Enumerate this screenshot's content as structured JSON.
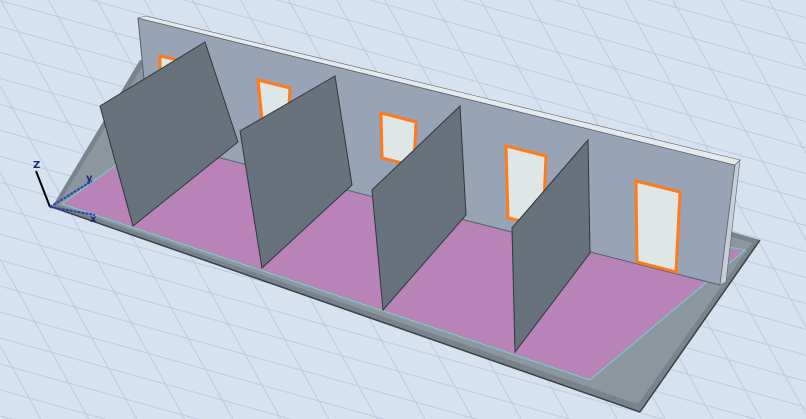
{
  "viewport": {
    "type": "3D model view",
    "axes": {
      "z": "Z",
      "y": "y",
      "x": "x"
    }
  },
  "colors": {
    "background": "#d6e2ef",
    "grid": "#b9cce3",
    "slab": "#78838c",
    "floor": "#b884b8",
    "wall": "#98a3b5",
    "partition": "#68727d",
    "door": "#ff7a1a",
    "selection": "#6fd6c8"
  },
  "model": {
    "partitions": 4,
    "doors": 5
  }
}
